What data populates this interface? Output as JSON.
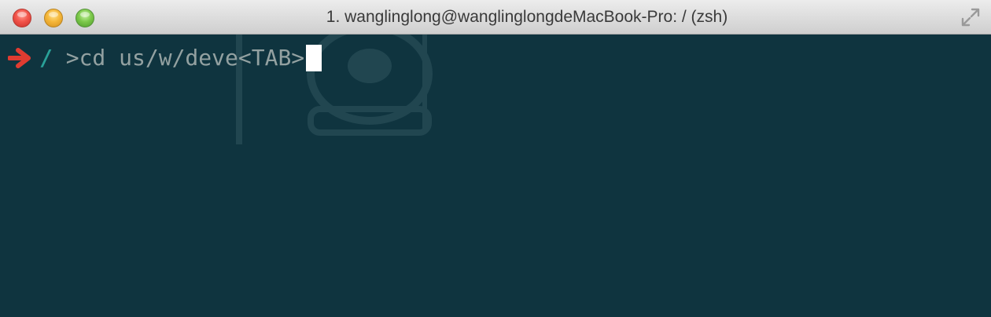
{
  "window": {
    "title": "1. wanglinglong@wanglinglongdeMacBook-Pro: / (zsh)"
  },
  "colors": {
    "terminal_background": "#0f343f",
    "prompt_arrow": "#e03c31",
    "prompt_cwd": "#2aa198",
    "command_text": "#93a1a1",
    "cursor": "#ffffff"
  },
  "terminal": {
    "prompt": {
      "arrow_icon": "right-arrow-icon",
      "cwd": "/",
      "separator": " ",
      "command": ">cd us/w/deve<TAB>"
    },
    "cursor": "block-cursor"
  }
}
